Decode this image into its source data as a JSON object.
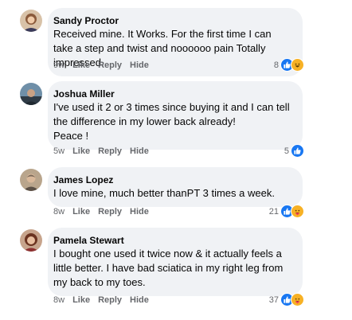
{
  "comments": [
    {
      "author": "Sandy Proctor",
      "text": "Received mine.  It Works.  For the first time I can take a step and twist and noooooo pain Totally impressed.",
      "time": "9w",
      "like_label": "Like",
      "reply_label": "Reply",
      "hide_label": "Hide",
      "reaction_count": "8",
      "reactions": [
        "like-icon",
        "haha-icon"
      ]
    },
    {
      "author": "Joshua Miller",
      "text": "I've used it 2 or 3 times since buying it and I can  tell the difference in my lower back already!\nPeace !",
      "time": "5w",
      "like_label": "Like",
      "reply_label": "Reply",
      "hide_label": "Hide",
      "reaction_count": "5",
      "reactions": [
        "like-icon"
      ]
    },
    {
      "author": "James Lopez",
      "text": "I love mine, much better thanPT 3 times a week.",
      "time": "8w",
      "like_label": "Like",
      "reply_label": "Reply",
      "hide_label": "Hide",
      "reaction_count": "21",
      "reactions": [
        "like-icon",
        "care-icon"
      ]
    },
    {
      "author": "Pamela Stewart",
      "text": "I bought one used it twice now & it actually feels a little better. I have bad sciatica in my right leg from my back to my toes.",
      "time": "8w",
      "like_label": "Like",
      "reply_label": "Reply",
      "hide_label": "Hide",
      "reaction_count": "37",
      "reactions": [
        "like-icon",
        "care-icon"
      ]
    }
  ],
  "colors": {
    "bubble": "#f0f2f5",
    "meta_text": "#65676b",
    "like_blue": "#1877f2",
    "reaction_yellow": "#f7b125"
  }
}
